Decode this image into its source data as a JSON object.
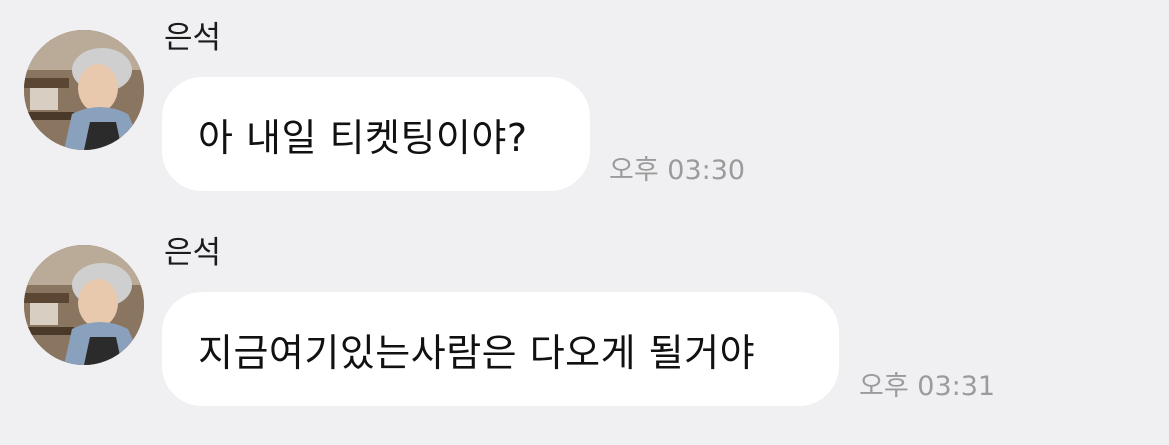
{
  "messages": [
    {
      "sender": "은석",
      "text": "아 내일 티켓팅이야?",
      "time": "오후 03:30",
      "avatar": "profile-photo"
    },
    {
      "sender": "은석",
      "text": "지금여기있는사람은 다오게 될거야",
      "time": "오후 03:31",
      "avatar": "profile-photo"
    }
  ],
  "colors": {
    "background": "#f0f0f2",
    "bubble": "#ffffff",
    "timestamp": "#9b9b9b"
  }
}
